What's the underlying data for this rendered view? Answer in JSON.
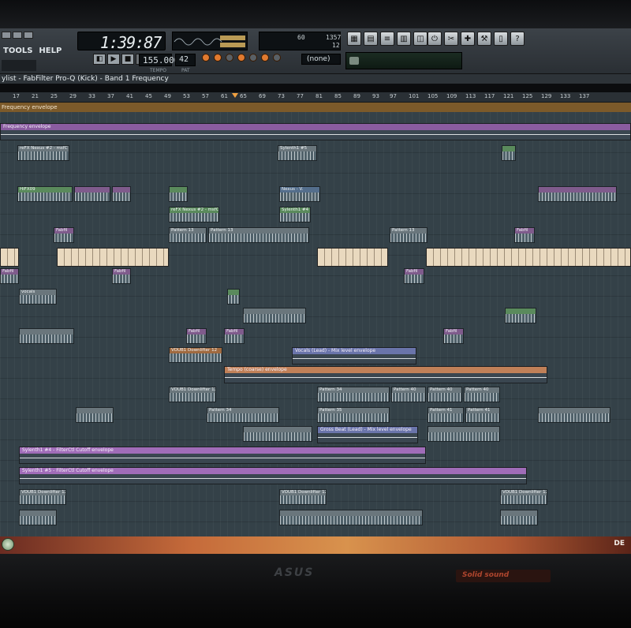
{
  "toolbar": {
    "menu": [
      "TOOLS",
      "HELP"
    ],
    "time": "1:39:87",
    "tempo": "155.000",
    "pattern": "42",
    "tempo_label": "TEMPO",
    "pattern_label": "PAT",
    "cpu_value": "60",
    "poly_value": "1357",
    "poly_sub": "12",
    "midi_none": "(none)",
    "icons_left": [
      "piano-roll-icon",
      "channel-rack-icon",
      "mixer-icon",
      "playlist-icon",
      "browser-icon"
    ],
    "icons_right": [
      "power-icon",
      "cut-icon",
      "plugin-icon",
      "wrench-icon",
      "document-icon",
      "help-icon"
    ]
  },
  "title": {
    "text": "ylist - FabFilter Pro-Q (Kick) - Band 1 Frequency"
  },
  "ruler": {
    "marks": [
      "17",
      "21",
      "25",
      "29",
      "33",
      "37",
      "41",
      "45",
      "49",
      "53",
      "57",
      "61",
      "65",
      "69",
      "73",
      "77",
      "81",
      "85",
      "89",
      "93",
      "97",
      "101",
      "105",
      "109",
      "113",
      "117",
      "121",
      "125",
      "129",
      "133",
      "137"
    ]
  },
  "freq_strip": {
    "label": "Frequency envelope"
  },
  "playlist": {
    "envelopes": [
      {
        "label": "Frequency envelope",
        "color": "#8a5ca0"
      },
      {
        "label": "Tempo (coarse) envelope",
        "color": "#c08058"
      },
      {
        "label": "Sylenth1 #4 - FilterCtl Cutoff envelope",
        "color": "#a06cb8"
      },
      {
        "label": "Sylenth1 #5 - FilterCtl Cutoff envelope",
        "color": "#a06cb8"
      },
      {
        "label": "Vocals (Lead) - Mix level envelope",
        "color": "#8790c0"
      },
      {
        "label": "Gross Beat (Lead) - Mix level envelope",
        "color": "#8790c0"
      }
    ],
    "clips": {
      "nexus_1": "reFX Nexus #2 - msfC",
      "hiaftap": "HiFX09",
      "sylenth1_5": "Sylenth1 #5",
      "nexus_2": "Nexus - V.",
      "nexus_3": "reFX Nexus #2 - msfC",
      "sylenth_4": "Sylenth1 #4",
      "fabfil": "Fabfil",
      "pattern_13a": "Pattern 13",
      "pattern_13b": "Pattern 13",
      "pattern_13c": "Pattern 13",
      "vocals": "vocals",
      "voub_1": "VOUB1 Downlifter 12",
      "voub_2": "VOUB1 Downlifter 12",
      "voub_3": "VOUB1 Downlifter 12",
      "voub_4": "VOUB1 Downlifter 12",
      "voub_5": "VOUB1 Downlifter 12",
      "pattern_34a": "Pattern 34",
      "pattern_34b": "Pattern 34",
      "pattern_35": "Pattern 35",
      "pattern_40a": "Pattern 40",
      "pattern_40b": "Pattern 40",
      "pattern_40c": "Pattern 40",
      "pattern_41a": "Pattern 41",
      "pattern_41b": "Pattern 41"
    }
  },
  "taskbar": {
    "lang": "DE"
  },
  "bezel": {
    "brand": "ASUS",
    "sticker": "Solid sound"
  }
}
